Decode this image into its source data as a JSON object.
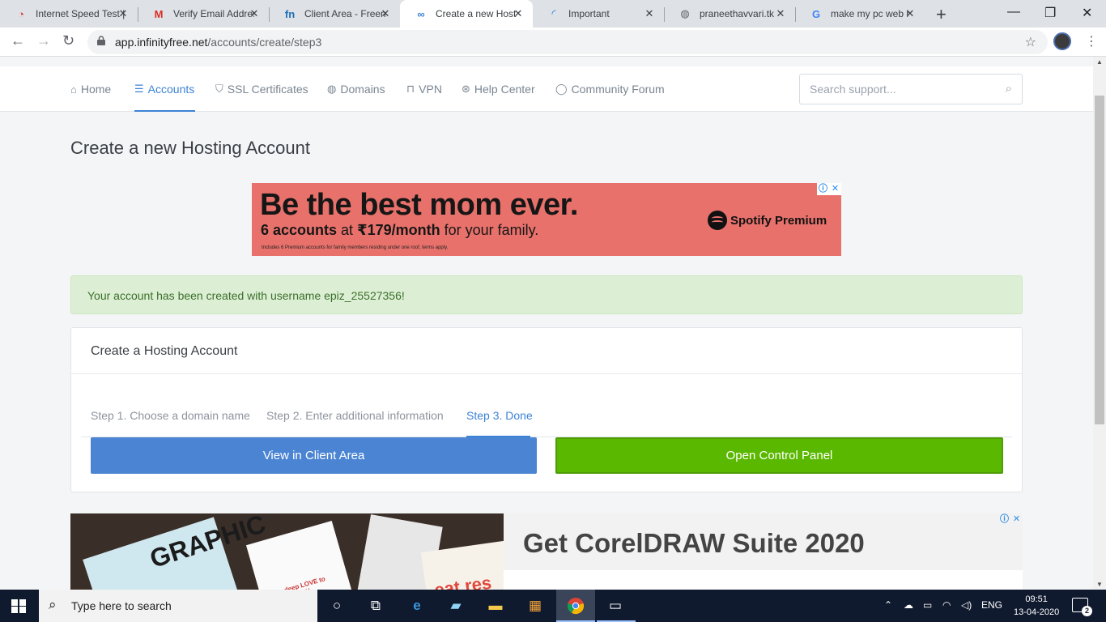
{
  "browser": {
    "tabs": [
      {
        "title": "Internet Speed Test | Fast.com",
        "favicon": "speedtest-icon",
        "active": false
      },
      {
        "title": "Verify Email Address",
        "favicon": "gmail-icon",
        "active": false
      },
      {
        "title": "Client Area - Freenom",
        "favicon": "freenom-icon",
        "active": false
      },
      {
        "title": "Create a new Hosting Account",
        "favicon": "infinityfree-icon",
        "active": true
      },
      {
        "title": "Important",
        "favicon": "loading-icon",
        "active": false
      },
      {
        "title": "praneethavvari.tk",
        "favicon": "globe-icon",
        "active": false
      },
      {
        "title": "make my pc web hosting",
        "favicon": "google-icon",
        "active": false
      }
    ],
    "url_host": "app.infinityfree.net",
    "url_path": "/accounts/create/step3"
  },
  "nav": {
    "items": [
      {
        "label": "Home",
        "icon": "home-icon"
      },
      {
        "label": "Accounts",
        "icon": "server-icon"
      },
      {
        "label": "SSL Certificates",
        "icon": "shield-icon"
      },
      {
        "label": "Domains",
        "icon": "globe-icon"
      },
      {
        "label": "VPN",
        "icon": "lock-icon"
      },
      {
        "label": "Help Center",
        "icon": "lifebuoy-icon"
      },
      {
        "label": "Community Forum",
        "icon": "chat-icon"
      }
    ],
    "active": "Accounts",
    "search_placeholder": "Search support..."
  },
  "page": {
    "title": "Create a new Hosting Account"
  },
  "ad_top": {
    "headline": "Be the best mom ever.",
    "sub_bold": "6 accounts",
    "sub_mid": " at ",
    "sub_price": "₹179/month",
    "sub_end": " for your family.",
    "fine_print": "Includes 6 Premium accounts for family members residing under one roof, terms apply.",
    "brand": "Spotify Premium",
    "bg_color": "#e8716b"
  },
  "alert": {
    "text": "Your account has been created with username epiz_25527356!",
    "color": "#dcefd4"
  },
  "card": {
    "title": "Create a Hosting Account",
    "steps": [
      "Step 1. Choose a domain name",
      "Step 2. Enter additional information",
      "Step 3. Done"
    ],
    "active_step": 3,
    "view_client_label": "View in Client Area",
    "open_panel_label": "Open Control Panel",
    "accent_blue": "#4a84d3",
    "accent_green": "#5bb800"
  },
  "ad_bottom": {
    "headline": "Get CorelDRAW Suite 2020",
    "mag1_text": "GRAPHIC",
    "mag2_text": "deep LOVE to DESIGN.",
    "mag4_text": "eat res"
  },
  "taskbar": {
    "search_text": "Type here to search",
    "language": "ENG",
    "time": "09:51",
    "date": "13-04-2020",
    "notifications": "2"
  }
}
